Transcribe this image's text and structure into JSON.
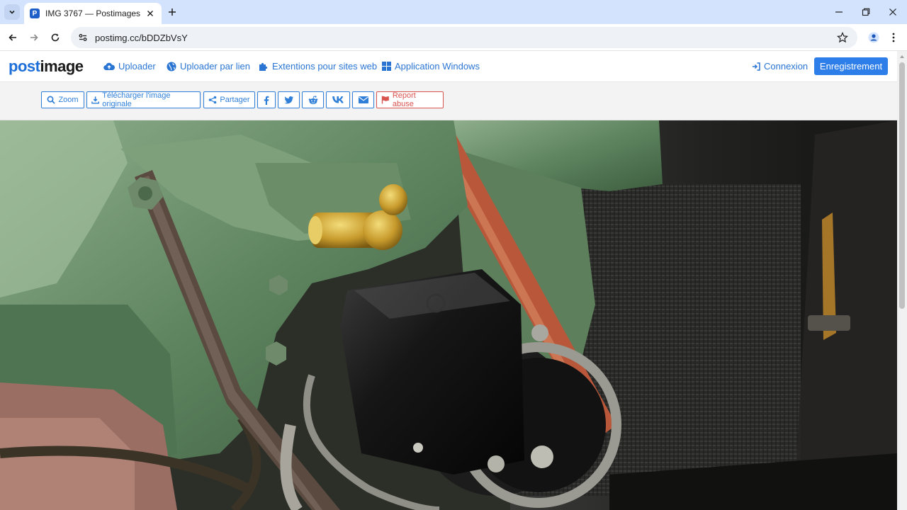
{
  "browser": {
    "tab_title": "IMG 3767 — Postimages",
    "url": "postimg.cc/bDDZbVsY"
  },
  "site": {
    "logo_part1": "post",
    "logo_part2": "image",
    "nav": {
      "uploader": "Uploader",
      "uploader_link": "Uploader par lien",
      "extensions": "Extentions pour sites web",
      "windows_app": "Application Windows"
    },
    "login": "Connexion",
    "register": "Enregistrement"
  },
  "actions": {
    "zoom": "Zoom",
    "download": "Télécharger l'image originale",
    "share": "Partager",
    "report": "Report abuse",
    "icons": [
      "facebook-icon",
      "twitter-icon",
      "reddit-icon",
      "vk-icon",
      "email-icon"
    ]
  },
  "colors": {
    "accent": "#2d7ee8",
    "link": "#2a75d3",
    "abuse": "#d9534f",
    "tabbar": "#d3e3fd"
  }
}
